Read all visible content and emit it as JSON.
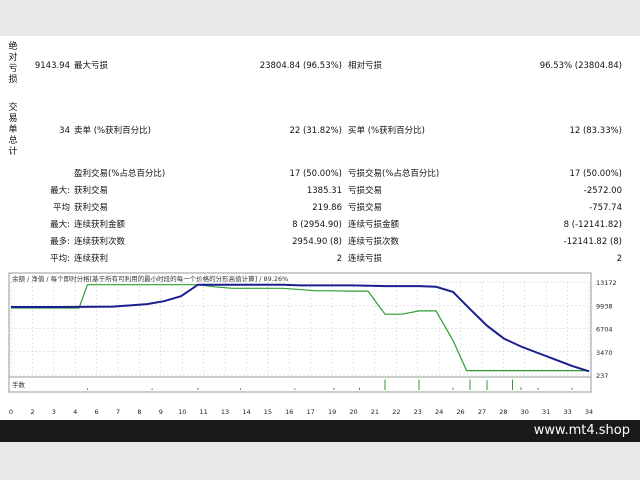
{
  "sections": {
    "absolute_label": [
      "绝",
      "对",
      "亏",
      "损"
    ],
    "trades_label": [
      "交",
      "易",
      "单",
      "总",
      "计"
    ]
  },
  "drawdown": {
    "absolute_value": "9143.94",
    "max_label": "最大亏损",
    "max_value": "23804.84 (96.53%)",
    "relative_label": "相对亏损",
    "relative_value": "96.53% (23804.84)"
  },
  "trades": {
    "total": "34",
    "short_label": "卖单 (%获利百分比)",
    "short_value": "22 (31.82%)",
    "long_label": "买单 (%获利百分比)",
    "long_value": "12 (83.33%)",
    "profit_trades_label": "盈利交易(%占总百分比)",
    "profit_trades_value": "17 (50.00%)",
    "loss_trades_label": "亏损交易(%占总百分比)",
    "loss_trades_value": "17 (50.00%)"
  },
  "stats_rows": [
    {
      "prefix": "最大:",
      "label1": "获利交易",
      "value1": "1385.31",
      "label2": "亏损交易",
      "value2": "-2572.00"
    },
    {
      "prefix": "平均",
      "label1": "获利交易",
      "value1": "219.86",
      "label2": "亏损交易",
      "value2": "-757.74"
    },
    {
      "prefix": "最大:",
      "label1": "连续获利金额",
      "value1": "8 (2954.90)",
      "label2": "连续亏损金额",
      "value2": "8 (-12141.82)"
    },
    {
      "prefix": "最多:",
      "label1": "连续获利次数",
      "value1": "2954.90 (8)",
      "label2": "连续亏损次数",
      "value2": "-12141.82 (8)"
    },
    {
      "prefix": "平均:",
      "label1": "连续获利",
      "value1": "2",
      "label2": "连续亏损",
      "value2": "2"
    }
  ],
  "chart_data": {
    "type": "line",
    "legend_text": "余额 / 净值 / 每个即时分格[基于所有可利用的最小时段的每一个价格的分形高值计算] / 89.26%",
    "volume_label": "手数",
    "y_ticks": [
      "13172",
      "9938",
      "6704",
      "3470",
      "237"
    ],
    "x_ticks": [
      "0",
      "2",
      "3",
      "4",
      "6",
      "7",
      "8",
      "9",
      "10",
      "11",
      "13",
      "14",
      "15",
      "16",
      "17",
      "19",
      "20",
      "21",
      "22",
      "23",
      "24",
      "26",
      "27",
      "28",
      "30",
      "31",
      "33",
      "34"
    ],
    "ylim": [
      237,
      13172
    ],
    "xlim": [
      0,
      34
    ],
    "colors": {
      "balance": "#1a1f8f",
      "equity": "#2f9e2f",
      "grid": "#c8c8c8",
      "volume": "#2f9e2f"
    },
    "series": [
      {
        "key": "balance",
        "x": [
          0,
          3,
          6,
          8,
          9,
          10,
          11,
          12,
          16,
          17,
          20,
          22,
          24,
          25,
          26,
          27,
          28,
          29,
          30,
          31,
          32,
          33,
          34
        ],
        "y": [
          9700,
          9700,
          9750,
          10100,
          10500,
          11200,
          12800,
          12800,
          12800,
          12700,
          12700,
          12600,
          12600,
          12500,
          11800,
          9400,
          7100,
          5300,
          4200,
          3300,
          2400,
          1500,
          750
        ]
      },
      {
        "key": "equity",
        "x": [
          0,
          4,
          4.5,
          11,
          12,
          13,
          16,
          18,
          19,
          20,
          21,
          22,
          23,
          24,
          25,
          26,
          26.8,
          27,
          34
        ],
        "y": [
          9550,
          9550,
          12800,
          12800,
          12500,
          12300,
          12300,
          11950,
          11950,
          11900,
          11900,
          8700,
          8700,
          9150,
          9150,
          5050,
          850,
          850,
          850
        ]
      }
    ],
    "volume_bars": [
      {
        "x": 4.5,
        "v": 0.15
      },
      {
        "x": 8.3,
        "v": 0.15
      },
      {
        "x": 11,
        "v": 0.2
      },
      {
        "x": 13.5,
        "v": 0.15
      },
      {
        "x": 16.7,
        "v": 0.15
      },
      {
        "x": 19,
        "v": 0.2
      },
      {
        "x": 20.5,
        "v": 0.2
      },
      {
        "x": 22,
        "v": 0.95
      },
      {
        "x": 24,
        "v": 0.95
      },
      {
        "x": 26,
        "v": 0.2
      },
      {
        "x": 27,
        "v": 0.95
      },
      {
        "x": 28,
        "v": 0.9
      },
      {
        "x": 29.5,
        "v": 0.95
      },
      {
        "x": 30,
        "v": 0.25
      },
      {
        "x": 31,
        "v": 0.2
      },
      {
        "x": 33,
        "v": 0.2
      }
    ]
  },
  "footer": {
    "site": "www.mt4.shop"
  }
}
